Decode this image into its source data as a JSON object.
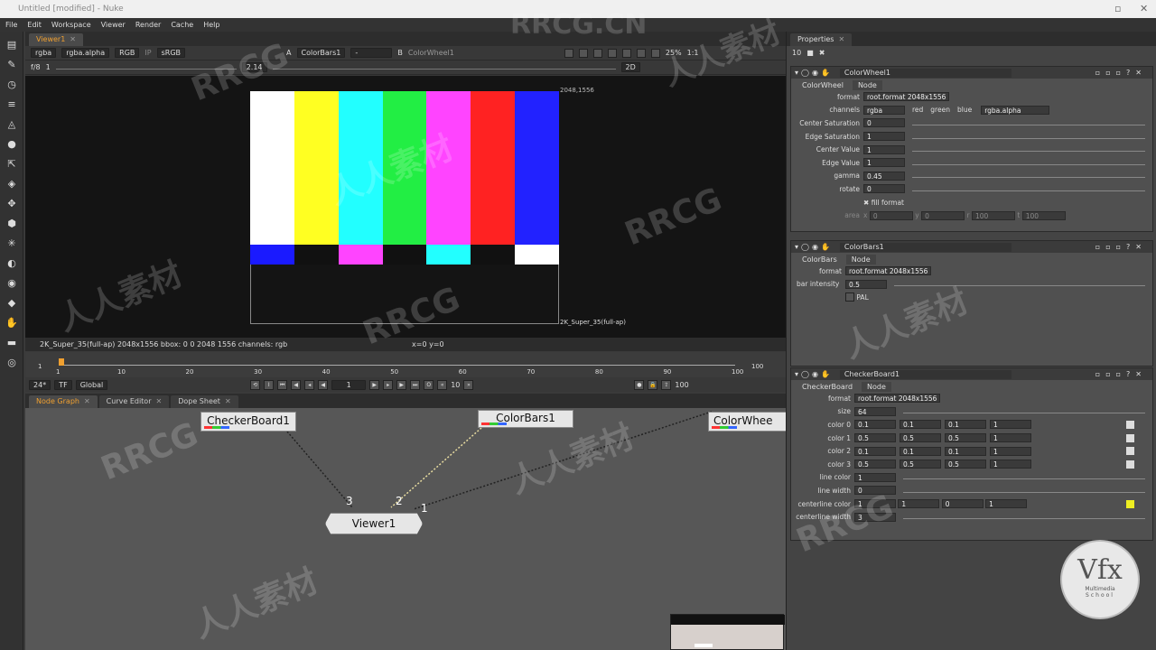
{
  "window": {
    "title": "Untitled [modified] - Nuke"
  },
  "menu": [
    "File",
    "Edit",
    "Workspace",
    "Viewer",
    "Render",
    "Cache",
    "Help"
  ],
  "viewer": {
    "tab": "Viewer1",
    "channels": "rgba",
    "alpha": "rgba.alpha",
    "display": "RGB",
    "ip": "IP",
    "lut": "sRGB",
    "inputA_label": "A",
    "inputA": "ColorBars1",
    "op": "-",
    "inputB_label": "B",
    "inputB": "ColorWheel1",
    "zoom": "25%",
    "ratio": "1:1",
    "mode": "2D",
    "fstop": "f/8",
    "gain": "1",
    "gamma": "2.14",
    "format_label": "2048,1556",
    "format_name": "2K_Super_35(full-ap)",
    "info": "2K_Super_35(full-ap) 2048x1556  bbox: 0 0 2048 1556 channels: rgb",
    "coords": "x=0 y=0",
    "bars_top": [
      "#ffffff",
      "#ffff22",
      "#22ffff",
      "#22ee44",
      "#ff44ff",
      "#ff2222",
      "#2222ff"
    ],
    "bars_mid": [
      "#1a1aff",
      "#111111",
      "#ff44ff",
      "#111111",
      "#22ffff",
      "#111111",
      "#ffffff"
    ],
    "bars_bot": [
      "#1f6ed8",
      "#ffffff",
      "#8a2be2",
      "#111111",
      "#111111",
      "#555555",
      "#111111"
    ]
  },
  "timeline": {
    "start": "1",
    "end": "100",
    "end2": "100",
    "ticks": [
      "1",
      "10",
      "20",
      "30",
      "40",
      "50",
      "60",
      "70",
      "80",
      "90",
      "100"
    ],
    "fps": "24*",
    "tf": "TF",
    "range": "Global",
    "frame": "1",
    "step": "10"
  },
  "bottom_tabs": [
    "Node Graph",
    "Curve Editor",
    "Dope Sheet"
  ],
  "nodes": {
    "checker": "CheckerBoard1",
    "colorbars": "ColorBars1",
    "colorwheel": "ColorWhee",
    "viewer": "Viewer1",
    "in3": "3",
    "in2": "2",
    "in1": "1"
  },
  "properties": {
    "tab": "Properties",
    "max": "10",
    "colorwheel": {
      "name": "ColorWheel1",
      "tab1": "ColorWheel",
      "tab2": "Node",
      "rows": [
        {
          "label": "format",
          "value": "root.format 2048x1556"
        },
        {
          "label": "channels",
          "value": "rgba"
        },
        {
          "label": "Center Saturation",
          "value": "0"
        },
        {
          "label": "Edge Saturation",
          "value": "1"
        },
        {
          "label": "Center Value",
          "value": "1"
        },
        {
          "label": "Edge Value",
          "value": "1"
        },
        {
          "label": "gamma",
          "value": "0.45"
        },
        {
          "label": "rotate",
          "value": "0"
        }
      ],
      "red": "red",
      "green": "green",
      "blue": "blue",
      "alpha": "rgba.alpha",
      "fill": "fill format",
      "area": "area",
      "area_x": "0",
      "area_y": "0",
      "area_r": "100",
      "area_t": "100"
    },
    "colorbars": {
      "name": "ColorBars1",
      "tab1": "ColorBars",
      "tab2": "Node",
      "format_label": "format",
      "format": "root.format 2048x1556",
      "intensity_label": "bar intensity",
      "intensity": "0.5",
      "pal": "PAL"
    },
    "checker": {
      "name": "CheckerBoard1",
      "tab1": "CheckerBoard",
      "tab2": "Node",
      "format_label": "format",
      "format": "root.format 2048x1556",
      "size_label": "size",
      "size": "64",
      "colors": [
        {
          "label": "color 0",
          "v": [
            "0.1",
            "0.1",
            "0.1",
            "1"
          ]
        },
        {
          "label": "color 1",
          "v": [
            "0.5",
            "0.5",
            "0.5",
            "1"
          ]
        },
        {
          "label": "color 2",
          "v": [
            "0.1",
            "0.1",
            "0.1",
            "1"
          ]
        },
        {
          "label": "color 3",
          "v": [
            "0.5",
            "0.5",
            "0.5",
            "1"
          ]
        }
      ],
      "linecolor_label": "line color",
      "linecolor": "1",
      "linewidth_label": "line width",
      "linewidth": "0",
      "centerline_label": "centerline color",
      "centerline": [
        "1",
        "1",
        "0",
        "1"
      ],
      "centerwidth_label": "centerline width",
      "centerwidth": "3"
    }
  },
  "watermarks": [
    "RRCG.CN",
    "人人素材",
    "RRCG",
    "人人素材",
    "RRCG",
    "人人素材",
    "RRCG",
    "人人素材",
    "RRCG",
    "人人素材",
    "RRCG",
    "人人素材"
  ],
  "logo": {
    "main": "Vfx",
    "sub1": "Multimedia",
    "sub2": "School"
  }
}
